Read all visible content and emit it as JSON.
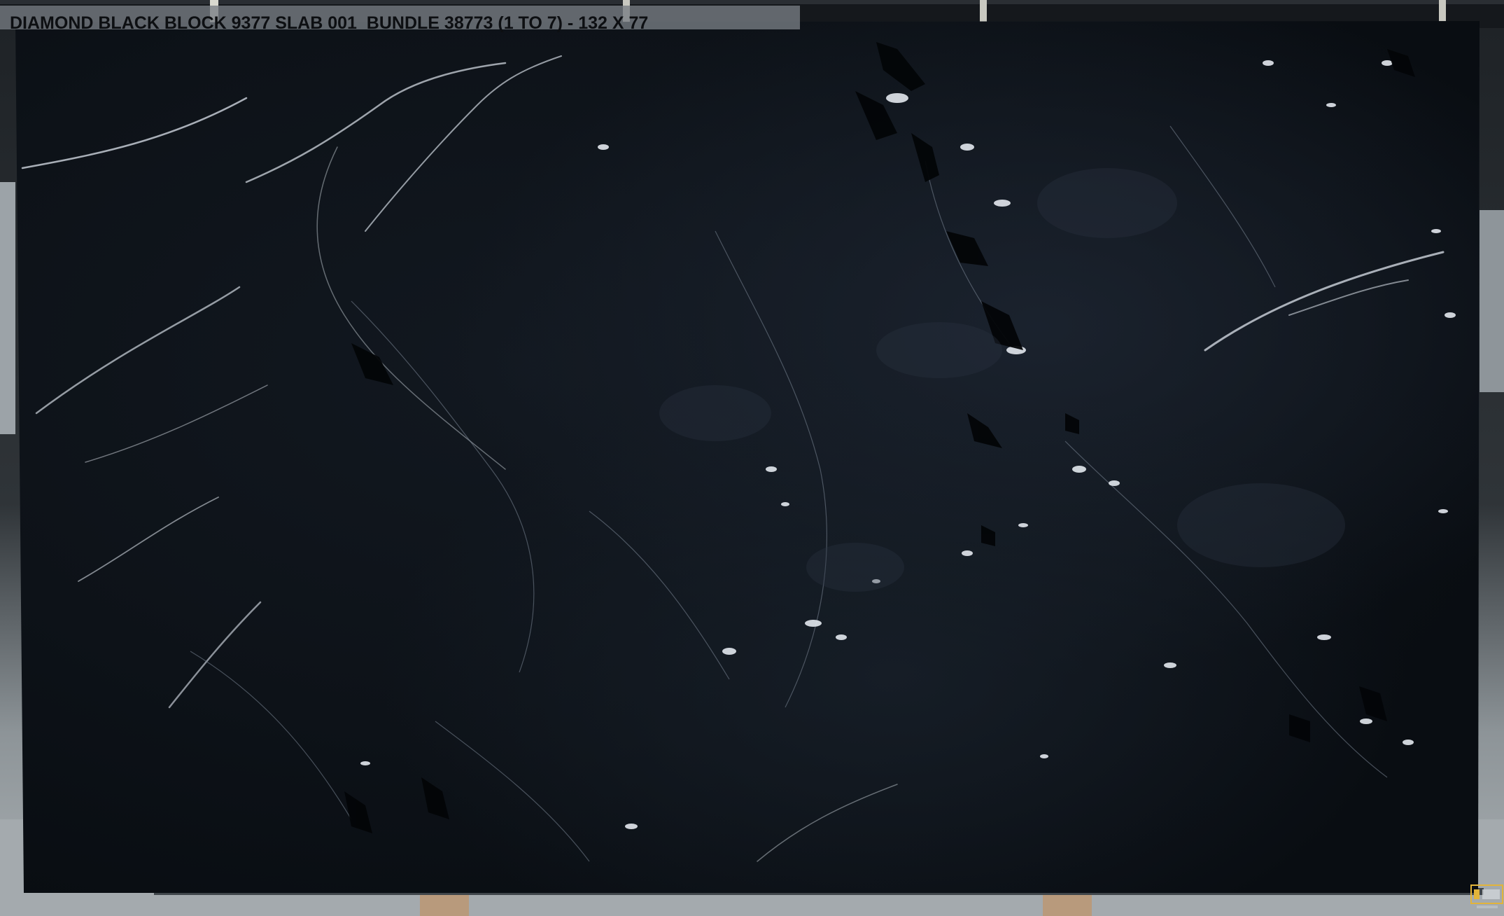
{
  "caption": {
    "text": "DIAMOND BLACK BLOCK 9377 SLAB 001  BUNDLE 38773 (1 TO 7) - 132 X 77"
  },
  "watermark": {
    "text": "PicSTONE"
  },
  "colors": {
    "slab_base": "#0f141b",
    "vein": "#d8dde3",
    "caption_bar": "#787e84",
    "floor": "#a9afb2",
    "logo_accent": "#e2b43a"
  }
}
